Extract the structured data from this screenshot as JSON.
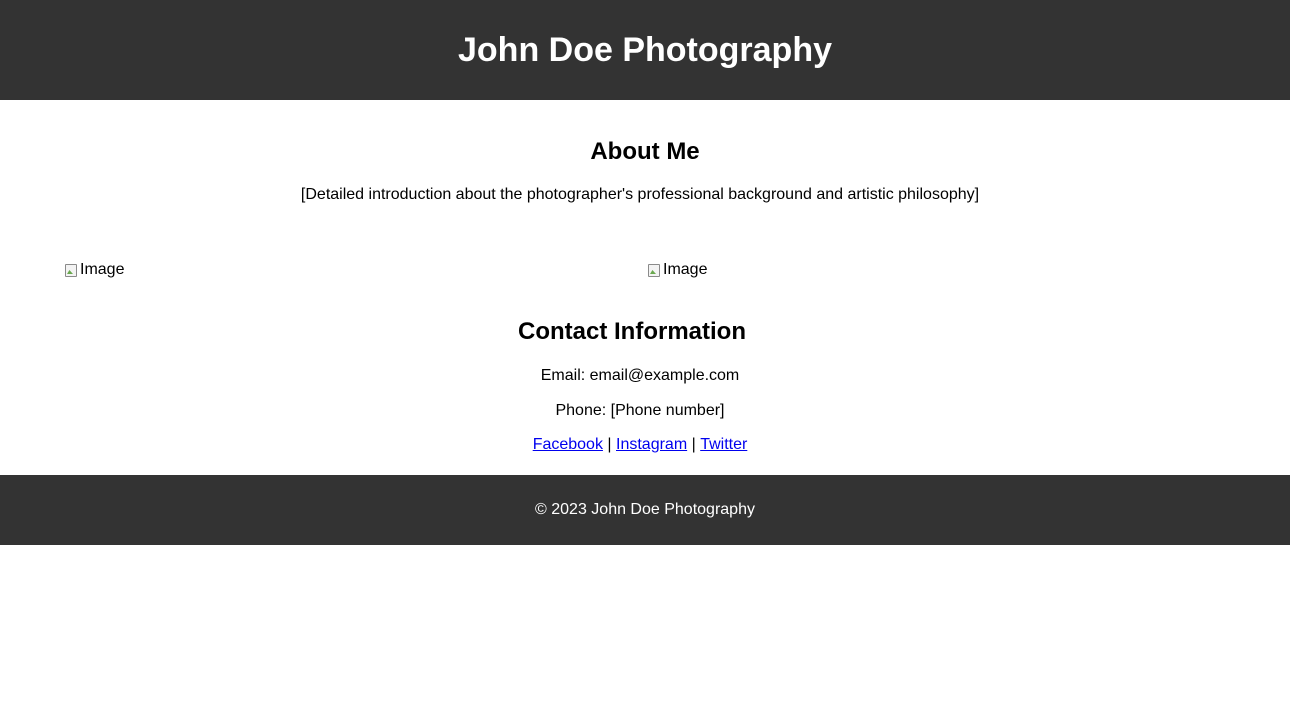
{
  "header": {
    "title": "John Doe Photography"
  },
  "about": {
    "heading": "About Me",
    "text": "[Detailed introduction about the photographer's professional background and artistic philosophy]"
  },
  "gallery": {
    "images": [
      {
        "alt": "Image"
      },
      {
        "alt": "Image"
      }
    ]
  },
  "contact": {
    "heading": "Contact Information",
    "email": "Email: email@example.com",
    "phone": "Phone: [Phone number]",
    "links": [
      "Facebook",
      "Instagram",
      "Twitter"
    ],
    "separator": " | "
  },
  "footer": {
    "copyright": "© 2023 John Doe Photography"
  },
  "colors": {
    "header_bg": "#333333",
    "footer_bg": "#333333",
    "link": "#0000ee"
  }
}
